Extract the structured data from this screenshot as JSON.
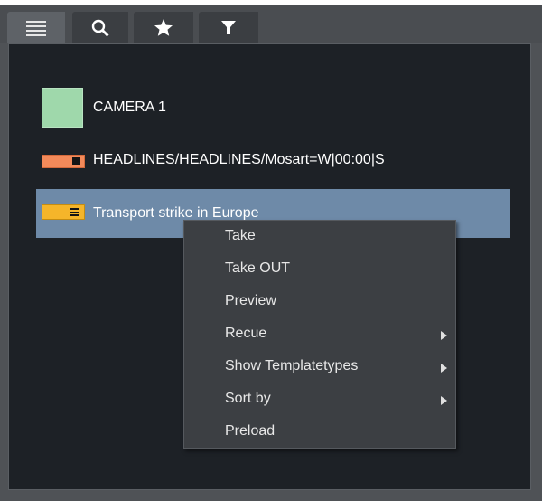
{
  "tabs": [
    {
      "icon": "list-icon",
      "active": true
    },
    {
      "icon": "search-icon",
      "active": false
    },
    {
      "icon": "star-icon",
      "active": false
    },
    {
      "icon": "filter-icon",
      "active": false
    }
  ],
  "items": [
    {
      "label": "CAMERA 1",
      "icon": "camera-swatch-icon",
      "color": "#9fd8ab"
    },
    {
      "label": "HEADLINES/HEADLINES/Mosart=W|00:00|S",
      "icon": "graphics-template-icon",
      "color": "#f38a5a"
    },
    {
      "label": "Transport strike in Europe",
      "icon": "story-icon",
      "color": "#f5b52a",
      "selected": true
    }
  ],
  "context_menu": {
    "items": [
      {
        "label": "Take",
        "submenu": false
      },
      {
        "label": "Take OUT",
        "submenu": false
      },
      {
        "label": "Preview",
        "submenu": false
      },
      {
        "label": "Recue",
        "submenu": true
      },
      {
        "label": "Show Templatetypes",
        "submenu": true
      },
      {
        "label": "Sort by",
        "submenu": true
      },
      {
        "label": "Preload",
        "submenu": false
      }
    ]
  },
  "colors": {
    "selection": "#6e8aa8",
    "panel_bg": "#1d2126",
    "menu_bg": "#3c3f43"
  }
}
